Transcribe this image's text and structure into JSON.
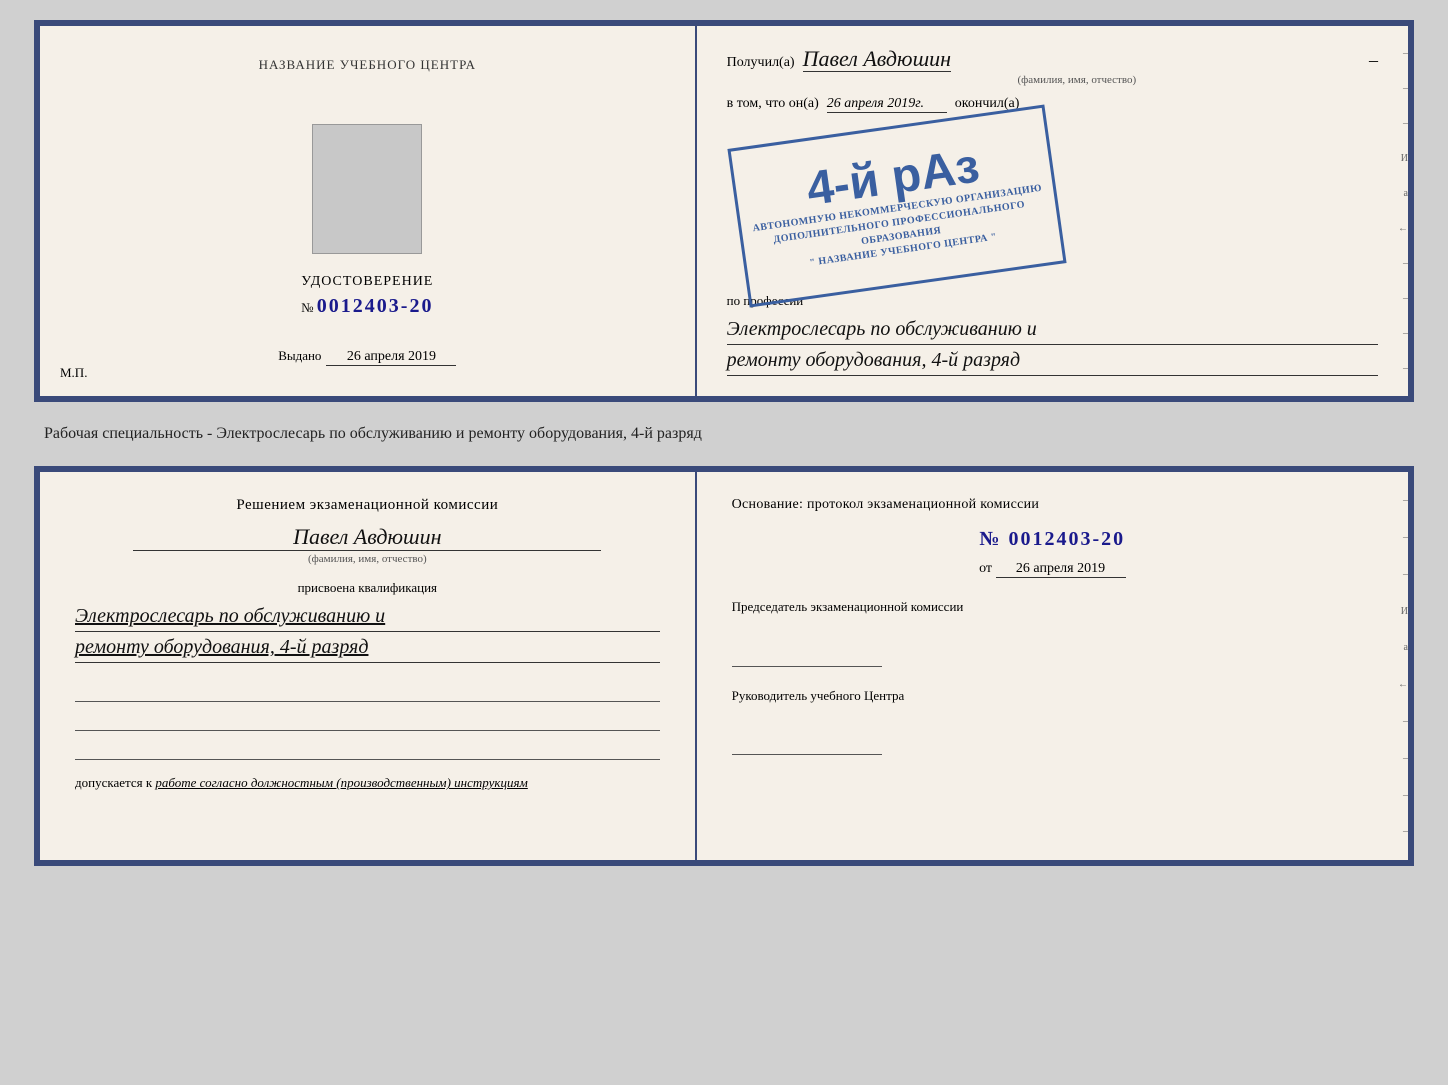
{
  "topCert": {
    "left": {
      "titleLine1": "НАЗВАНИЕ УЧЕБНОГО ЦЕНТРА",
      "docType": "УДОСТОВЕРЕНИЕ",
      "docNumberPrefix": "№",
      "docNumber": "0012403-20",
      "issuedLabel": "Выдано",
      "issuedDate": "26 апреля 2019",
      "mpLabel": "М.П."
    },
    "right": {
      "recipientPrefix": "Получил(а)",
      "recipientName": "Павел Авдюшин",
      "recipientSubLabel": "(фамилия, имя, отчество)",
      "vtomLabel": "в том, что он(а)",
      "vtomDate": "26 апреля 2019г.",
      "okonchilLabel": "окончил(а)",
      "stampGrade": "4-й рАз",
      "stampLine1": "АВТОНОМНУЮ НЕКОММЕРЧЕСКУЮ ОРГАНИЗАЦИЮ",
      "stampLine2": "ДОПОЛНИТЕЛЬНОГО ПРОФЕССИОНАЛЬНОГО ОБРАЗОВАНИЯ",
      "stampLine3": "\" НАЗВАНИЕ УЧЕБНОГО ЦЕНТРА \"",
      "professionLabel": "по профессии",
      "professionValue": "Электрослесарь по обслуживанию и",
      "professionValue2": "ремонту оборудования, 4-й разряд"
    }
  },
  "betweenText": "Рабочая специальность - Электрослесарь по обслуживанию и ремонту оборудования, 4-й разряд",
  "bottomCert": {
    "left": {
      "decisionTitle": "Решением экзаменационной комиссии",
      "personName": "Павел Авдюшин",
      "personSubLabel": "(фамилия, имя, отчество)",
      "qualificationLabel": "присвоена квалификация",
      "qualificationValue1": "Электрослесарь по обслуживанию и",
      "qualificationValue2": "ремонту оборудования, 4-й разряд",
      "допускаетсяLabel": "допускается к",
      "допускаетсяValue": "работе согласно должностным (производственным) инструкциям"
    },
    "right": {
      "основаниеTitle": "Основание: протокол экзаменационной комиссии",
      "protocolPrefix": "№",
      "protocolNumber": "0012403-20",
      "datePrefix": "от",
      "protocolDate": "26 апреля 2019",
      "chairmanLabel": "Председатель экзаменационной комиссии",
      "руководительLabel": "Руководитель учебного Центра"
    }
  },
  "rightDecorations": [
    "И",
    "а",
    "←",
    "–",
    "–",
    "–",
    "–"
  ],
  "rightDecorationsBottom": [
    "–",
    "–",
    "–",
    "И",
    "а",
    "←",
    "–",
    "–",
    "–",
    "–"
  ]
}
